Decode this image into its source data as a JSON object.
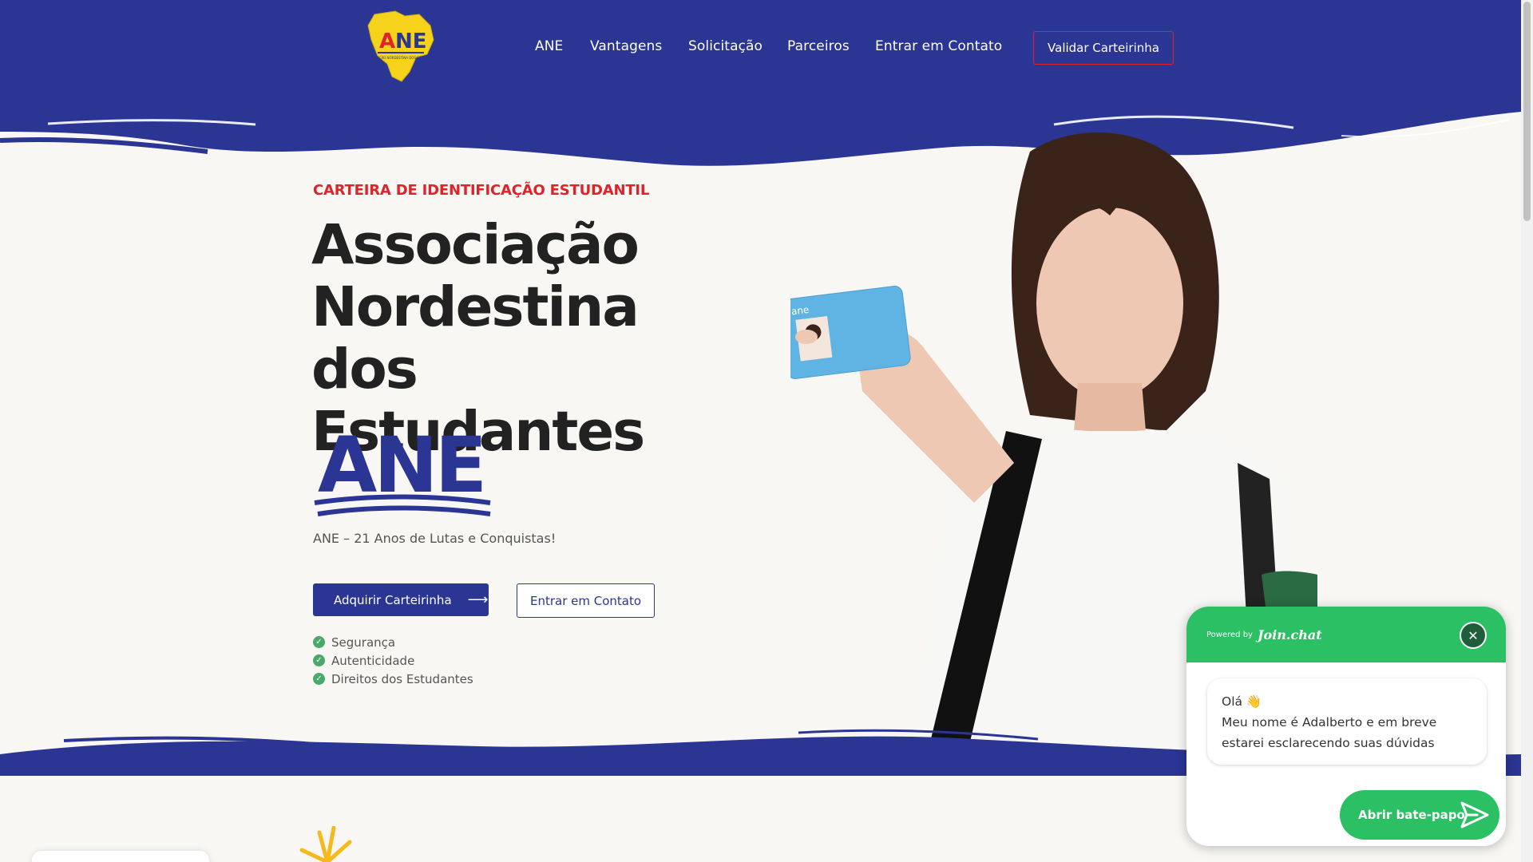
{
  "header": {
    "logo_text": "ANE",
    "logo_subtext": "ASSOCIAÇÃO NORDESTINA DOS ESTUDANTES",
    "nav": [
      "ANE",
      "Vantagens",
      "Solicitação",
      "Parceiros",
      "Entrar em Contato"
    ],
    "validate_button": "Validar Carteirinha"
  },
  "hero": {
    "eyebrow": "CARTEIRA DE IDENTIFICAÇÃO ESTUDANTIL",
    "title_lines": [
      "Associação",
      "Nordestina dos",
      "Estudantes"
    ],
    "ane_wordmark": "ANE",
    "tagline": "ANE – 21 Anos de Lutas e Conquistas!",
    "primary_button": "Adquirir Carteirinha",
    "secondary_button": "Entrar em Contato",
    "features": [
      "Segurança",
      "Autenticidade",
      "Direitos dos Estudantes"
    ],
    "card_brand": "ane"
  },
  "chat": {
    "powered_by": "Powered by",
    "brand": "Join.chat",
    "greeting": "Olá 👋",
    "message": "Meu nome é Adalberto e em breve estarei esclarecendo suas dúvidas",
    "cta": "Abrir bate-papo"
  },
  "colors": {
    "brand_blue": "#2b3593",
    "accent_red": "#e0222a",
    "chat_green": "#2ac063",
    "logo_yellow": "#f6d21b"
  }
}
